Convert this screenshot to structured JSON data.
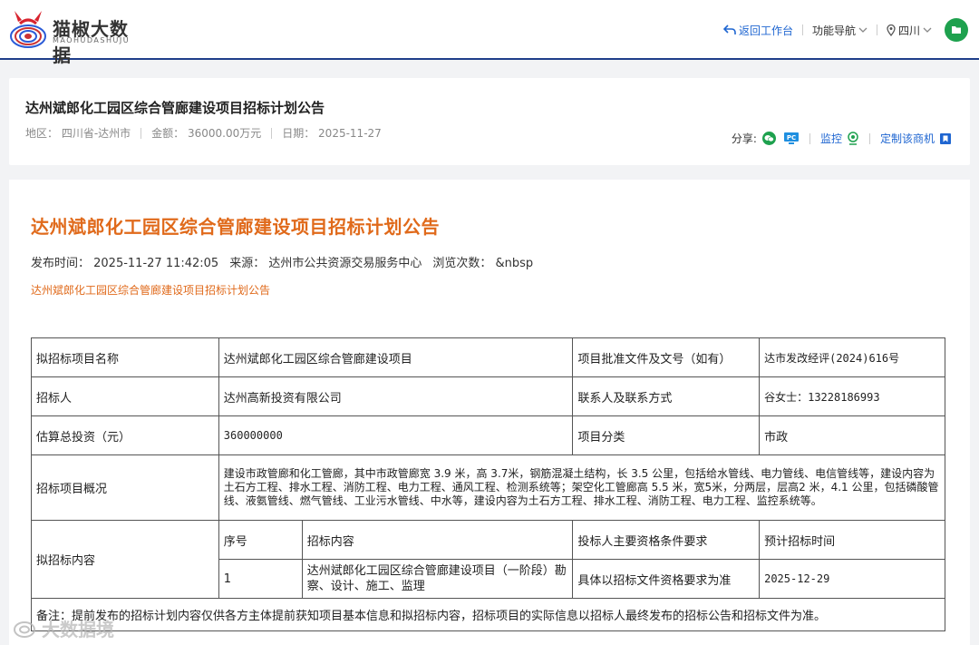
{
  "header": {
    "brand_name": "猫椒大数据",
    "brand_sub": "MAOHUDASHUJU",
    "back_label": "返回工作台",
    "nav_label": "功能导航",
    "region_label": "四川"
  },
  "summary": {
    "title": "达州斌郎化工园区综合管廊建设项目招标计划公告",
    "region": "地区：  四川省-达州市",
    "amount": "金额：  36000.00万元",
    "date": "日期：  2025-11-27",
    "share_label": "分享:",
    "monitor_label": "监控",
    "custom_label": "定制该商机"
  },
  "doc": {
    "title": "达州斌郎化工园区综合管廊建设项目招标计划公告",
    "publish_time": "发布时间：  2025-11-27 11:42:05",
    "source": "来源：  达州市公共资源交易服务中心",
    "views": "浏览次数：  &nbsp",
    "subtitle": "达州斌郎化工园区综合管廊建设项目招标计划公告",
    "table": {
      "name_label": "拟招标项目名称",
      "name_value": "达州斌郎化工园区综合管廊建设项目",
      "approval_label": "项目批准文件及文号（如有）",
      "approval_value": "达市发改经评(2024)616号",
      "tenderer_label": "招标人",
      "tenderer_value": "达州高新投资有限公司",
      "contact_label": "联系人及联系方式",
      "contact_value": "谷女士：13228186993",
      "invest_label": "估算总投资（元）",
      "invest_value": "360000000",
      "category_label": "项目分类",
      "category_value": "市政",
      "overview_label": "招标项目概况",
      "overview_value": "建设市政管廊和化工管廊，其中市政管廊宽 3.9 米，高 3.7米，钢筋混凝土结构，长 3.5 公里，包括给水管线、电力管线、电信管线等，建设内容为土石方工程、排水工程、消防工程、电力工程、通风工程、检测系统等；架空化工管廊高 5.5 米，宽5米，分两层，层高2 米，4.1 公里，包括磷酸管线、液氨管线、燃气管线、工业污水管线、中水等，建设内容为土石方工程、排水工程、消防工程、电力工程、监控系统等。",
      "content_label": "拟招标内容",
      "col_seq": "序号",
      "col_content": "招标内容",
      "col_qual": "投标人主要资格条件要求",
      "col_time": "预计招标时间",
      "row_seq": "1",
      "row_content": "达州斌郎化工园区综合管廊建设项目（一阶段）勘察、设计、施工、监理",
      "row_qual": "具体以招标文件资格要求为准",
      "row_time": "2025-12-29",
      "note": "备注：提前发布的招标计划内容仅供各方主体提前获知项目基本信息和拟招标内容，招标项目的实际信息以招标人最终发布的招标公告和招标文件为准。"
    }
  },
  "watermark": "大数据境",
  "colors": {
    "accent_orange": "#e06a1b",
    "link_blue": "#1f66d1",
    "nav_border": "#1f3e8a",
    "green": "#1ea14e"
  }
}
